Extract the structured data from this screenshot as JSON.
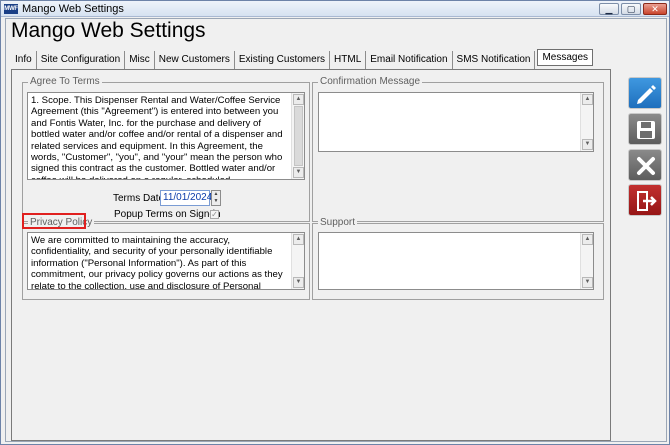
{
  "window": {
    "logo_text": "MWF",
    "title": "Mango Web Settings",
    "min_glyph": "▁",
    "max_glyph": "▢",
    "close_glyph": "✕"
  },
  "app": {
    "title": "Mango Web Settings"
  },
  "tabs": [
    {
      "label": "Info"
    },
    {
      "label": "Site Configuration"
    },
    {
      "label": "Misc"
    },
    {
      "label": "New Customers"
    },
    {
      "label": "Existing Customers"
    },
    {
      "label": "HTML"
    },
    {
      "label": "Email Notification"
    },
    {
      "label": "SMS Notification"
    },
    {
      "label": "Messages",
      "active": true
    }
  ],
  "agree_to_terms": {
    "label": "Agree To Terms",
    "text": "1. Scope.  This Dispenser Rental and Water/Coffee Service Agreement (this \"Agreement\") is entered into between you and Fontis Water, Inc. for the purchase and delivery of bottled water and/or coffee and/or rental of a dispenser and related services and equipment.  In this Agreement, the words, \"Customer\", \"you\", and \"your\" mean the person who signed this contract as the customer. Bottled water and/or coffee will be delivered on a regular, scheduled, replenishment basis.",
    "terms_date_label": "Terms Date",
    "terms_date_value": "11/01/2024",
    "popup_label": "Popup Terms on Sign-in",
    "popup_checked": true
  },
  "confirmation_message": {
    "label": "Confirmation Message",
    "text": ""
  },
  "privacy_policy": {
    "label": "Privacy Policy",
    "text": "We are committed to maintaining the accuracy, confidentiality, and security of your personally identifiable information (\"Personal Information\"). As part of this commitment, our privacy policy governs our actions as they relate to the collection, use and disclosure of Personal Information."
  },
  "support": {
    "label": "Support",
    "text": ""
  },
  "colors": {
    "highlight": "#e0201f",
    "edit_button": "#2a7fd0",
    "exit_button": "#b02222"
  },
  "toolbar": {
    "edit_icon": "pencil-icon",
    "save_icon": "floppy-disk-icon",
    "cancel_icon": "x-icon",
    "exit_icon": "exit-door-icon"
  }
}
